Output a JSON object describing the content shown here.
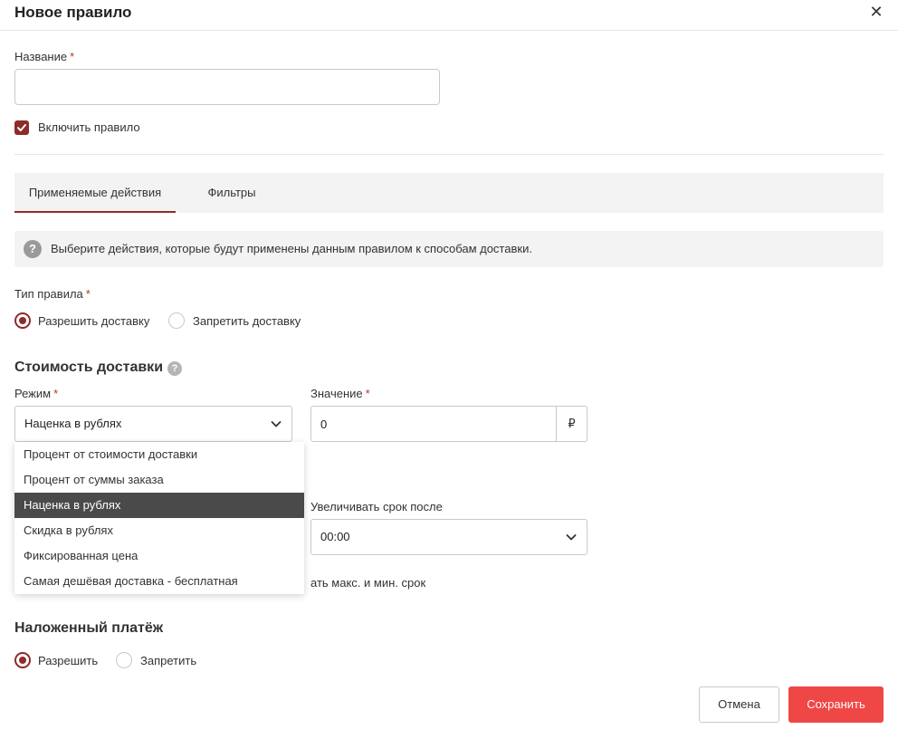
{
  "header": {
    "title": "Новое правило",
    "close": "✕"
  },
  "name_field": {
    "label": "Название",
    "required": "*",
    "value": ""
  },
  "enable_rule": {
    "label": "Включить правило",
    "checked": true
  },
  "tabs": [
    {
      "label": "Применяемые действия",
      "active": true
    },
    {
      "label": "Фильтры",
      "active": false
    }
  ],
  "info": {
    "text": "Выберите действия, которые будут применены данным правилом к способам доставки."
  },
  "rule_type": {
    "label": "Тип правила",
    "required": "*",
    "options": [
      {
        "label": "Разрешить доставку",
        "selected": true
      },
      {
        "label": "Запретить доставку",
        "selected": false
      }
    ]
  },
  "delivery_cost": {
    "title": "Стоимость доставки",
    "mode": {
      "label": "Режим",
      "required": "*",
      "selected": "Наценка в рублях",
      "options": [
        "Процент от стоимости доставки",
        "Процент от суммы заказа",
        "Наценка в рублях",
        "Скидка в рублях",
        "Фиксированная цена",
        "Самая дешёвая доставка - бесплатная"
      ]
    },
    "value": {
      "label": "Значение",
      "required": "*",
      "value": "0",
      "suffix": "₽"
    }
  },
  "extend_term": {
    "label": "Увеличивать срок после",
    "value": "00:00"
  },
  "partial_text": "ать макс. и мин. срок",
  "cod": {
    "title": "Наложенный платёж",
    "options": [
      {
        "label": "Разрешить",
        "selected": true
      },
      {
        "label": "Запретить",
        "selected": false
      }
    ]
  },
  "footer": {
    "cancel": "Отмена",
    "save": "Сохранить"
  },
  "colors": {
    "accent": "#8e2b2b",
    "save": "#ef4646"
  }
}
